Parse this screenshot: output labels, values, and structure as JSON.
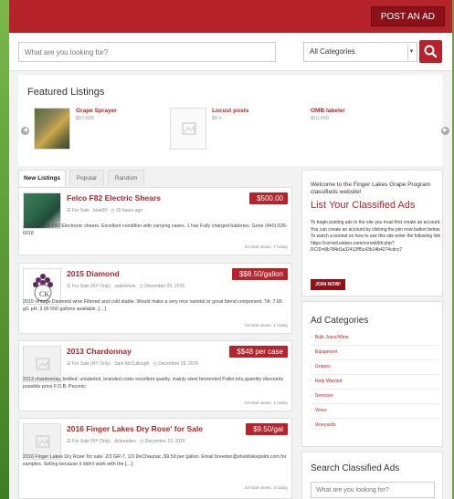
{
  "header": {
    "post_ad_label": "POST AN AD"
  },
  "search": {
    "placeholder": "What are you looking for?",
    "category_selected": "All Categories"
  },
  "featured": {
    "title": "Featured Listings",
    "items": [
      {
        "title": "Grape Sprayer",
        "price": "$57,600"
      },
      {
        "title": "Locust posts",
        "price": "$8 #"
      },
      {
        "title": "OMB labeler",
        "price": "$10,000"
      }
    ]
  },
  "tabs": [
    "New Listings",
    "Popular",
    "Random"
  ],
  "listings": [
    {
      "title": "Felco F82 Electric Shears",
      "price": "$500.00",
      "meta_category": "For Sale",
      "meta_user": "blue69",
      "meta_time": "15 hours ago",
      "description": "2 pairs Felco F82 Electronic shears. Excellent condition with carrying cases. 1 has Fully charged batteries. Gene (440)-536-6018",
      "views": "10 total views, 7 today"
    },
    {
      "title": "2015 Diamond",
      "price": "$$8.50/gallon",
      "meta_category": "For Sale (NY Only)",
      "meta_user": "sadielewis",
      "meta_time": "December 20, 2016",
      "description": "2015 vintage Diamond wine.Filtered and cold stable. Would make a very nice varietal or great blend component. TA: 7.65 g/L pH: 3.06 650 gallons available. […]",
      "views": "19 total views, 1 today"
    },
    {
      "title": "2013 Chardonnay",
      "price": "$$48 per case",
      "meta_category": "For Sale (NY Only)",
      "meta_user": "Sam McCullough",
      "meta_time": "December 19, 2016",
      "description": "2013 chardonnay, bottled, unlabeled, branded corks excellent quality, mainly steel fermented Pallet lots,quantity discounts possible price F.O.B. Peconic",
      "views": "19 total views, 1 today"
    },
    {
      "title": "2016 Finger Lakes Dry Rose' for Sale",
      "price": "$9.50/gal",
      "meta_category": "For Sale (NY Only)",
      "meta_user": "dcbreeden",
      "meta_time": "December 19, 2016",
      "description": "2016 Finger Lakes Dry Rose' for sale. 2/3 GR-7, 1/3 DeChaunac, $9.50 per gallon. Email breeden@sheldrakepoint.com for samples. Selling because it didn't work with the […]",
      "views": "33 total views, 0 today"
    }
  ],
  "welcome": {
    "small": "Welcome to the Finger Lakes Grape Program classifieds website!",
    "big": "List Your Classified Ads",
    "text": "To begin posting ads to the site you must first create an account. You can create an account by clicking the join now button below. To watch a tutorial on how to use this site enter the following link https://cornell.webex.com/cornell/ldr.php?RCID=8b784d1a32412ff5c43b14b4274cdcc7",
    "join_label": "JOIN NOW!"
  },
  "categories": {
    "title": "Ad Categories",
    "items": [
      "Bulk Juice/Wine",
      "Equipment",
      "Grapes",
      "Help Wanted",
      "Services",
      "Vines",
      "Vineyards"
    ]
  },
  "search_box": {
    "title": "Search Classified Ads",
    "placeholder": "What are you looking for?"
  },
  "colors": {
    "brand_red": "#b7232b",
    "dark_red": "#8c1219",
    "frame_green": "#6aa53a"
  }
}
